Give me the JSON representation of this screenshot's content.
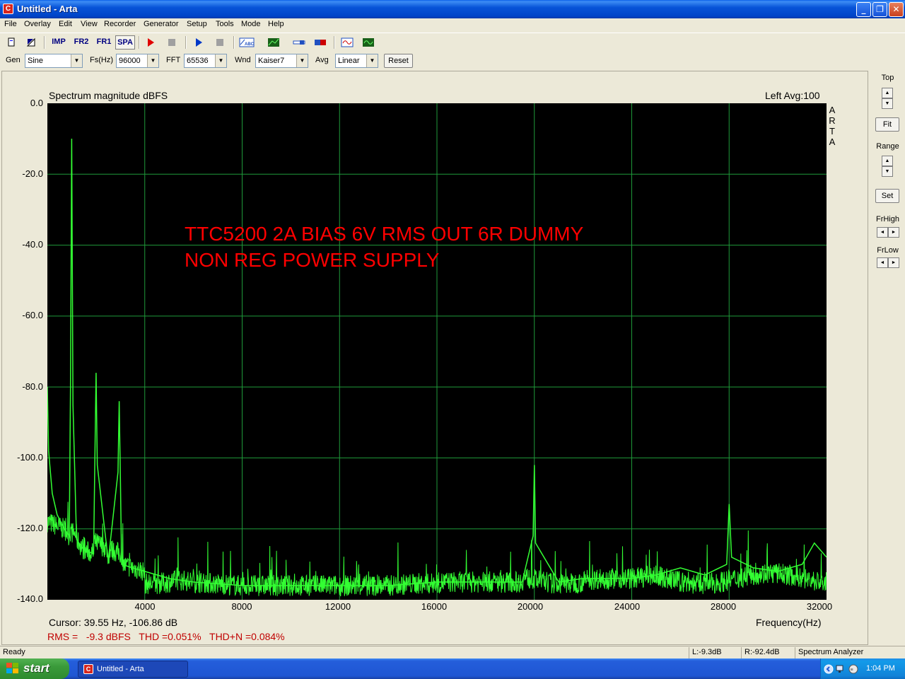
{
  "window": {
    "icon_letter": "C",
    "title": "Untitled - Arta",
    "minimize_glyph": "_",
    "maximize_glyph": "❐",
    "close_glyph": "✕"
  },
  "menu": [
    "File",
    "Overlay",
    "Edit",
    "View",
    "Recorder",
    "Generator",
    "Setup",
    "Tools",
    "Mode",
    "Help"
  ],
  "toolbar": {
    "imp": "IMP",
    "fr2": "FR2",
    "fr1": "FR1",
    "spa": "SPA",
    "active_tool": "SPA"
  },
  "controls": {
    "gen_label": "Gen",
    "gen_value": "Sine",
    "fs_label": "Fs(Hz)",
    "fs_value": "96000",
    "fft_label": "FFT",
    "fft_value": "65536",
    "wnd_label": "Wnd",
    "wnd_value": "Kaiser7",
    "avg_label": "Avg",
    "avg_value": "Linear",
    "reset_label": "Reset"
  },
  "plot": {
    "title": "Spectrum magnitude dBFS",
    "channel_info": "Left  Avg:100",
    "brand": [
      "A",
      "R",
      "T",
      "A"
    ],
    "annotation_line1": "TTC5200 2A BIAS 6V RMS OUT 6R DUMMY",
    "annotation_line2": "NON REG POWER SUPPLY",
    "cursor": "Cursor: 39.55 Hz, -106.86 dB",
    "xaxis_title": "Frequency(Hz)",
    "measurements": "RMS =   -9.3 dBFS   THD =0.051%   THD+N =0.084%",
    "colors": {
      "background": "#000000",
      "grid": "#1f9a3a",
      "trace": "#33ff33",
      "annotation": "#ff0000",
      "measurements": "#c00000"
    }
  },
  "chart_data": {
    "type": "line",
    "title": "Spectrum magnitude dBFS",
    "xlabel": "Frequency(Hz)",
    "ylabel": "",
    "xlim": [
      0,
      32000
    ],
    "ylim": [
      -140,
      0
    ],
    "grid": true,
    "x_ticks": [
      "4000",
      "8000",
      "12000",
      "16000",
      "20000",
      "24000",
      "28000",
      "32000"
    ],
    "y_ticks": [
      "0.0",
      "-20.0",
      "-40.0",
      "-60.0",
      "-80.0",
      "-100.0",
      "-120.0",
      "-140.0"
    ],
    "series": [
      {
        "x": [
          0,
          50,
          200,
          400,
          700,
          900,
          950,
          1000,
          1050,
          1200,
          1500,
          1900,
          1950,
          2000,
          2050,
          2500,
          2900,
          2950,
          3000,
          3050,
          3500,
          4000,
          5000,
          6000,
          8000,
          10000,
          12000,
          14000,
          16000,
          18000,
          19500,
          19950,
          20000,
          20050,
          21000,
          22000,
          24000,
          25000,
          26000,
          27000,
          27900,
          28000,
          28100,
          29000,
          30000,
          31000,
          31500,
          32000
        ],
        "y": [
          -80,
          -98,
          -110,
          -116,
          -120,
          -122,
          -80,
          -10,
          -85,
          -123,
          -126,
          -127,
          -100,
          -76,
          -102,
          -129,
          -104,
          -84,
          -106,
          -130,
          -131,
          -132,
          -134,
          -135,
          -136,
          -136,
          -136,
          -136,
          -135,
          -135,
          -135,
          -122,
          -102,
          -124,
          -135,
          -134,
          -134,
          -133,
          -131,
          -133,
          -130,
          -113,
          -128,
          -131,
          -132,
          -130,
          -124,
          -128
        ]
      }
    ]
  },
  "sidepanel": {
    "top_label": "Top",
    "fit_label": "Fit",
    "range_label": "Range",
    "set_label": "Set",
    "frhigh_label": "FrHigh",
    "frlow_label": "FrLow"
  },
  "status": {
    "ready": "Ready",
    "left_level": "L:-9.3dB",
    "right_level": "R:-92.4dB",
    "mode": "Spectrum Analyzer"
  },
  "taskbar": {
    "start_label": "start",
    "task_title": "Untitled - Arta",
    "clock": "1:04 PM"
  }
}
